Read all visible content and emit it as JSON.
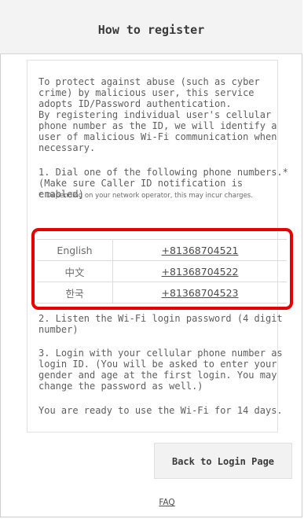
{
  "header": {
    "title": "How to register"
  },
  "intro": "To protect against abuse (such as cyber crime) by malicious user, this service adopts ID/Password authentication.\nBy registering individual user's cellular phone number as the ID, we will identify a user of malicious Wi-Fi communication when necessary.",
  "step1": {
    "text": "1. Dial one of the following phone numbers.*",
    "sub": "(Make sure Caller ID notification is enabled)",
    "footnote": "*: Depending on your network operator, this may incur charges."
  },
  "phones": [
    {
      "lang": "English",
      "number": "+81368704521"
    },
    {
      "lang": "中文",
      "number": "+81368704522"
    },
    {
      "lang": "한국",
      "number": "+81368704523"
    }
  ],
  "step2": "2. Listen the Wi-Fi login password (4 digit number)",
  "step3": "3. Login with your cellular phone number as login ID. (You will be asked to enter your gender and age at the first login. You may change the password as well.)",
  "ready": "You are ready to use the Wi-Fi for 14 days.",
  "buttons": {
    "back": "Back to Login Page"
  },
  "links": {
    "faq": "FAQ"
  },
  "colors": {
    "highlight": "#e60000",
    "header_bg": "#f3f3f3"
  }
}
